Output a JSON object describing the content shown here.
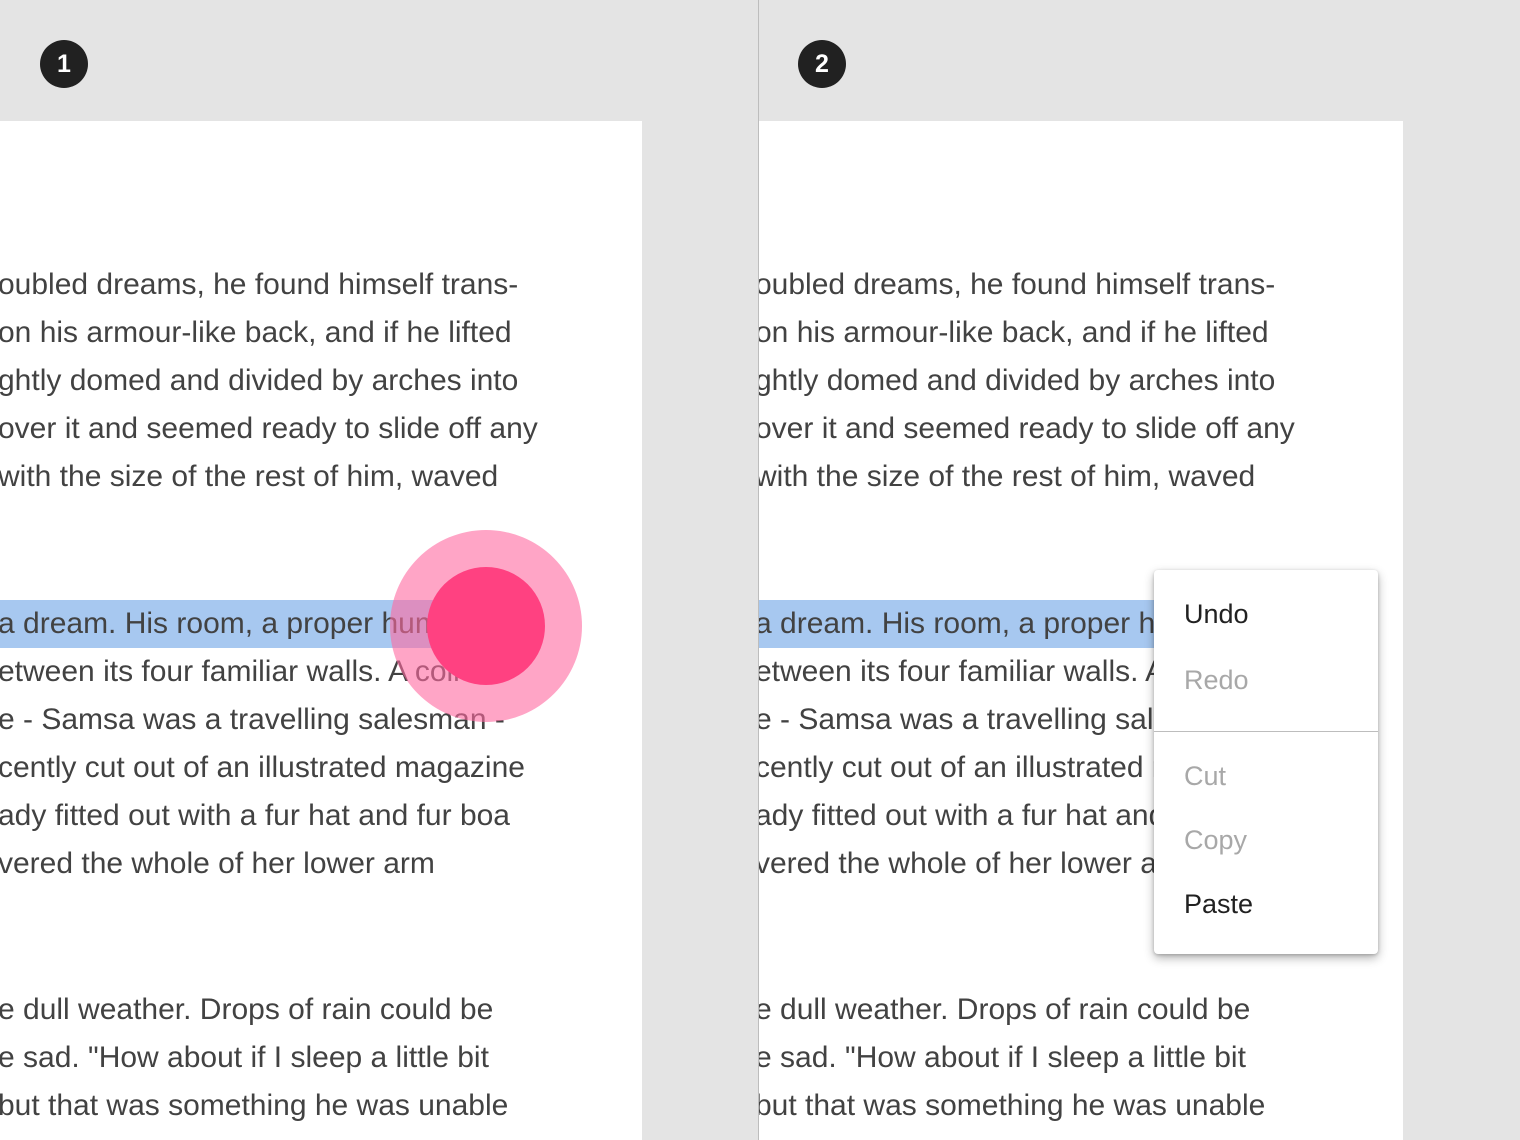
{
  "steps": [
    "1",
    "2"
  ],
  "document": {
    "paragraph_1": [
      "oubled dreams, he found himself trans-",
      "on his armour-like back, and if he lifted",
      "ghtly domed and divided by arches into",
      "over it and seemed ready to slide off any",
      "with the size of the rest of him, waved"
    ],
    "paragraph_2": [
      "a dream. His room, a proper human",
      "etween its four familiar walls. A collec-",
      "e - Samsa was a travelling salesman -",
      "cently cut out of an illustrated magazine",
      "ady fitted out with a fur hat and fur boa",
      "vered the whole of her lower arm"
    ],
    "paragraph_3": [
      "e dull weather. Drops of rain could be",
      "e sad. \"How about if I sleep a little bit",
      "but that was something he was unable"
    ]
  },
  "context_menu": {
    "items": [
      {
        "label": "Undo",
        "enabled": true
      },
      {
        "label": "Redo",
        "enabled": false
      },
      {
        "label": "Cut",
        "enabled": false
      },
      {
        "label": "Copy",
        "enabled": false
      },
      {
        "label": "Paste",
        "enabled": true
      }
    ]
  },
  "colors": {
    "selection": "#a7c8f0",
    "touch_ripple": "#ff4181",
    "badge": "#212121",
    "background": "#e4e4e4"
  }
}
